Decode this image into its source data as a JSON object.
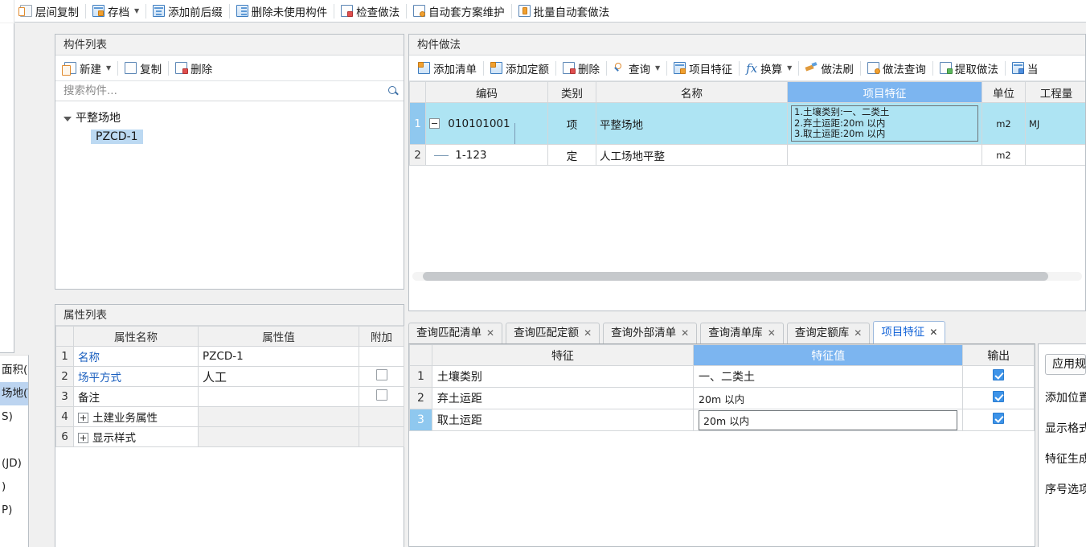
{
  "toolbar": {
    "buttons": [
      {
        "label": "层间复制",
        "icon": "layer-copy-icon",
        "caret": false
      },
      {
        "label": "存档",
        "icon": "archive-icon",
        "caret": true
      },
      {
        "label": "添加前后缀",
        "icon": "add-affix-icon",
        "caret": false
      },
      {
        "label": "删除未使用构件",
        "icon": "delete-unused-icon",
        "caret": false
      },
      {
        "label": "检查做法",
        "icon": "check-method-icon",
        "caret": false
      },
      {
        "label": "自动套方案维护",
        "icon": "auto-scheme-icon",
        "caret": false
      },
      {
        "label": "批量自动套做法",
        "icon": "batch-auto-icon",
        "caret": false
      }
    ]
  },
  "left_menu": {
    "items": [
      {
        "label": "面积(U)",
        "selected": false
      },
      {
        "label": "场地(V)",
        "selected": true
      },
      {
        "label": "S)",
        "selected": false
      },
      {
        "label": "",
        "selected": false
      },
      {
        "label": "(JD)",
        "selected": false
      },
      {
        "label": ")",
        "selected": false
      },
      {
        "label": "P)",
        "selected": false
      }
    ]
  },
  "component_list": {
    "title": "构件列表",
    "tools": [
      {
        "label": "新建",
        "icon": "new-icon",
        "caret": true
      },
      {
        "label": "复制",
        "icon": "copy-icon",
        "caret": false
      },
      {
        "label": "删除",
        "icon": "delete-icon",
        "caret": false
      }
    ],
    "search_placeholder": "搜索构件...",
    "tree": {
      "group": "平整场地",
      "leaf": "PZCD-1"
    }
  },
  "property_list": {
    "title": "属性列表",
    "headers": [
      "",
      "属性名称",
      "属性值",
      "附加"
    ],
    "rows": [
      {
        "num": "1",
        "name": "名称",
        "value": "PZCD-1",
        "link": true,
        "checkbox": "none"
      },
      {
        "num": "2",
        "name": "场平方式",
        "value": "人工",
        "link": true,
        "checkbox": "off"
      },
      {
        "num": "3",
        "name": "备注",
        "value": "",
        "link": false,
        "checkbox": "off"
      },
      {
        "num": "4",
        "name": "土建业务属性",
        "value": "",
        "link": false,
        "checkbox": "none",
        "expandable": true
      },
      {
        "num": "6",
        "name": "显示样式",
        "value": "",
        "link": false,
        "checkbox": "none",
        "expandable": true
      }
    ]
  },
  "component_method": {
    "title": "构件做法",
    "tools": [
      {
        "label": "添加清单",
        "icon": "add-list-icon",
        "caret": false
      },
      {
        "label": "添加定额",
        "icon": "add-quota-icon",
        "caret": false
      },
      {
        "label": "删除",
        "icon": "delete-icon",
        "caret": false
      },
      {
        "label": "查询",
        "icon": "query-icon",
        "caret": true
      },
      {
        "label": "项目特征",
        "icon": "project-feature-icon",
        "caret": false
      },
      {
        "label": "换算",
        "icon": "convert-icon",
        "caret": true
      },
      {
        "label": "做法刷",
        "icon": "method-brush-icon",
        "caret": false
      },
      {
        "label": "做法查询",
        "icon": "method-query-icon",
        "caret": false
      },
      {
        "label": "提取做法",
        "icon": "extract-method-icon",
        "caret": false
      },
      {
        "label": "当",
        "icon": "current-icon",
        "caret": false
      }
    ],
    "headers": [
      "",
      "编码",
      "类别",
      "名称",
      "项目特征",
      "单位",
      "工程量"
    ],
    "highlight_column": "项目特征",
    "rows": [
      {
        "num": "1",
        "code": "010101001",
        "category": "项",
        "name": "平整场地",
        "feature": "1.土壤类别:一、二类土\n2.弃土运距:20m 以内\n3.取土运距:20m 以内",
        "unit": "m2",
        "quantity": "MJ",
        "selected": true,
        "expander": "minus"
      },
      {
        "num": "2",
        "code": "1-123",
        "category": "定",
        "name": "人工场地平整",
        "feature": "",
        "unit": "m2",
        "quantity": "",
        "selected": false,
        "expander": "child"
      }
    ]
  },
  "tabs": [
    {
      "label": "查询匹配清单",
      "active": false
    },
    {
      "label": "查询匹配定额",
      "active": false
    },
    {
      "label": "查询外部清单",
      "active": false
    },
    {
      "label": "查询清单库",
      "active": false
    },
    {
      "label": "查询定额库",
      "active": false
    },
    {
      "label": "项目特征",
      "active": true
    }
  ],
  "feature_panel": {
    "headers": [
      "",
      "特征",
      "特征值",
      "输出"
    ],
    "highlight_column": "特征值",
    "rows": [
      {
        "num": "1",
        "feature": "土壤类别",
        "value": "一、二类土",
        "output": true,
        "selected": false,
        "editing": false
      },
      {
        "num": "2",
        "feature": "弃土运距",
        "value": "20m 以内",
        "output": true,
        "selected": false,
        "editing": false
      },
      {
        "num": "3",
        "feature": "取土运距",
        "value": "20m 以内",
        "output": true,
        "selected": true,
        "editing": true
      }
    ]
  },
  "side_panel": {
    "button": "应用规",
    "links": [
      "添加位置",
      "显示格式",
      "特征生成",
      "序号选项"
    ]
  },
  "colors": {
    "header_highlight": "#7cb5f0",
    "row_selected": "#aee4f3",
    "rownum_selected": "#8fc8ef",
    "tree_selected": "#bcd9f2",
    "tab_active_text": "#1565d8",
    "link": "#1a5fbf",
    "checkbox_on": "#3d93e8"
  }
}
